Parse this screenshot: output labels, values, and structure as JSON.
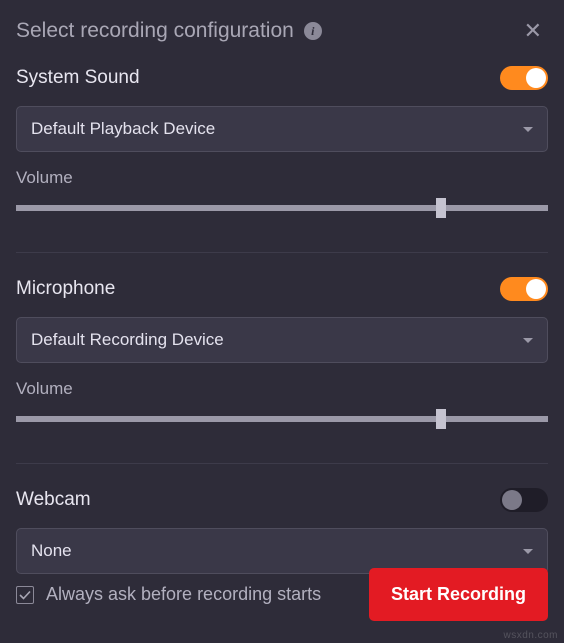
{
  "header": {
    "title": "Select recording configuration"
  },
  "systemSound": {
    "title": "System Sound",
    "enabled": true,
    "device": "Default Playback Device",
    "volumeLabel": "Volume",
    "volumePercent": 79
  },
  "microphone": {
    "title": "Microphone",
    "enabled": true,
    "device": "Default Recording Device",
    "volumeLabel": "Volume",
    "volumePercent": 79
  },
  "webcam": {
    "title": "Webcam",
    "enabled": false,
    "device": "None"
  },
  "footer": {
    "alwaysAskChecked": true,
    "alwaysAskLabel": "Always ask before recording starts",
    "startButton": "Start Recording"
  },
  "colors": {
    "accent": "#ff8a1e",
    "danger": "#e31b23",
    "background": "#2e2c39"
  }
}
